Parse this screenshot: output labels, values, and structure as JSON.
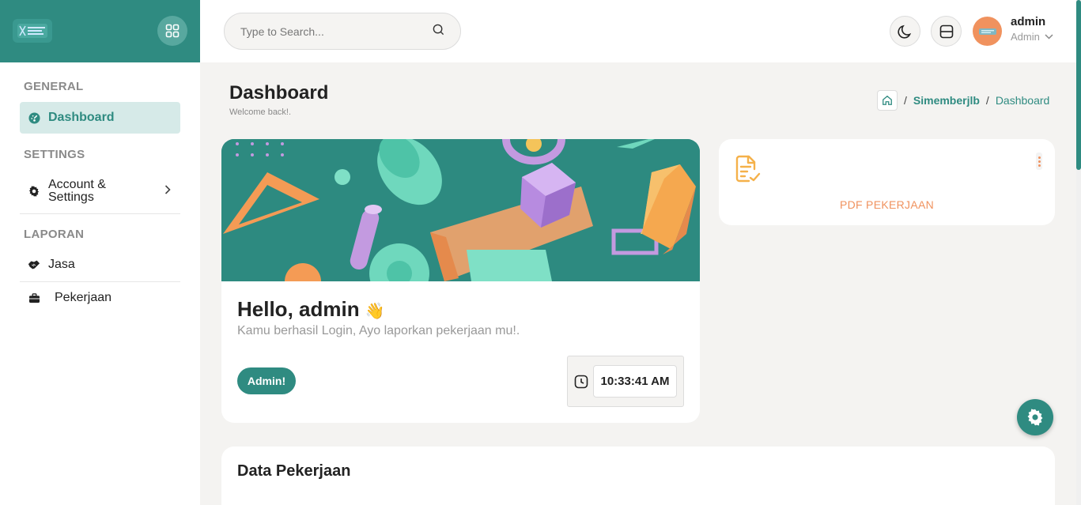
{
  "sidebar": {
    "sections": [
      {
        "title": "GENERAL"
      },
      {
        "title": "SETTINGS"
      },
      {
        "title": "LAPORAN"
      }
    ],
    "items": [
      {
        "label": "Dashboard",
        "icon": "gauge-icon",
        "active": true
      },
      {
        "label": "Account &",
        "label2": "Settings",
        "icon": "gear-icon"
      },
      {
        "label": "Jasa",
        "icon": "handshake-icon"
      },
      {
        "label": "Pekerjaan",
        "icon": "briefcase-icon"
      }
    ]
  },
  "topbar": {
    "search_placeholder": "Type to Search...",
    "user": {
      "name": "admin",
      "role": "Admin"
    }
  },
  "page": {
    "title": "Dashboard",
    "subtitle": "Welcome back!.",
    "breadcrumb": [
      "Simemberjlb",
      "Dashboard"
    ]
  },
  "hello_card": {
    "greeting": "Hello, admin",
    "emoji": "👋",
    "message": "Kamu berhasil Login, Ayo laporkan pekerjaan mu!.",
    "button": "Admin!",
    "time": "10:33:41 AM"
  },
  "pdf_card": {
    "label": "PDF PEKERJAAN"
  },
  "data_card": {
    "title": "Data Pekerjaan"
  },
  "colors": {
    "primary": "#2f8b81",
    "accent": "#f0925e",
    "background": "#f4f3f1"
  }
}
